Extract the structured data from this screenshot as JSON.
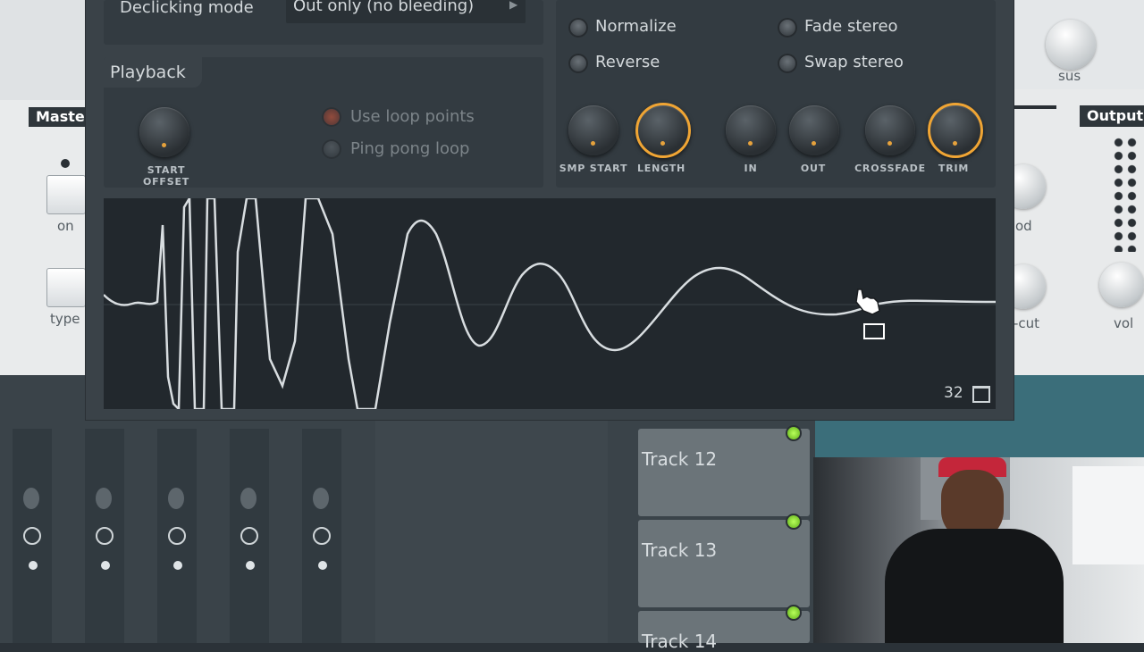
{
  "background": {
    "left_panel": {
      "title": "Maste",
      "on_label": "on",
      "type_label": "type"
    },
    "right_panel": {
      "title": "Output",
      "sus_label": "sus",
      "mod_label": "od",
      "cut_label": "-cut",
      "vol_label": "vol"
    }
  },
  "dialog": {
    "declicking": {
      "label": "Declicking mode",
      "value": "Out only (no bleeding)"
    },
    "playback": {
      "title": "Playback",
      "start_offset_label": "START OFFSET",
      "use_loop_points_label": "Use loop points",
      "ping_pong_loop_label": "Ping pong loop"
    },
    "options": {
      "normalize_label": "Normalize",
      "reverse_label": "Reverse",
      "fade_stereo_label": "Fade stereo",
      "swap_stereo_label": "Swap stereo"
    },
    "knobs": {
      "smp_start": "SMP START",
      "length": "LENGTH",
      "in": "IN",
      "out": "OUT",
      "crossfade": "CROSSFADE",
      "trim": "TRIM"
    },
    "waveform": {
      "zoom_value": "32"
    }
  },
  "playlist": {
    "tracks": [
      {
        "label": "Track 12"
      },
      {
        "label": "Track 13"
      },
      {
        "label": "Track 14"
      }
    ]
  },
  "colors": {
    "accent_orange": "#f0a534",
    "led_green": "#8ee03a"
  }
}
